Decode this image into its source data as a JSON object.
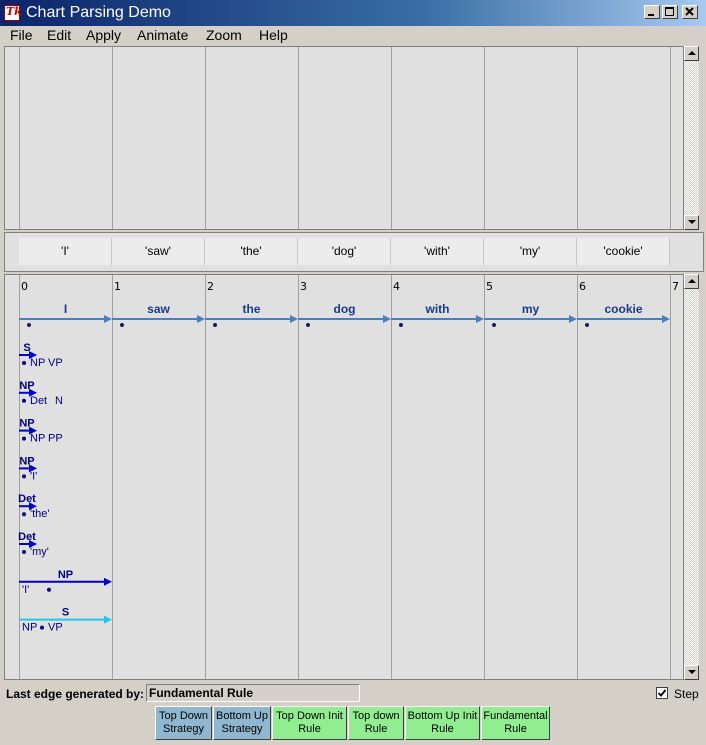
{
  "window": {
    "title": "Chart Parsing Demo"
  },
  "menu": [
    "File",
    "Edit",
    "Apply",
    "Animate",
    "Zoom",
    "Help"
  ],
  "tokens": [
    "'I'",
    "'saw'",
    "'the'",
    "'dog'",
    "'with'",
    "'my'",
    "'cookie'"
  ],
  "indices": [
    "0",
    "1",
    "2",
    "3",
    "4",
    "5",
    "6",
    "7"
  ],
  "words": [
    "I",
    "saw",
    "the",
    "dog",
    "with",
    "my",
    "cookie"
  ],
  "edges": [
    {
      "lhs": "S",
      "rhs": "NP VP",
      "start": 0,
      "end": 0,
      "dot": 0
    },
    {
      "lhs": "NP",
      "rhs": "Det N",
      "start": 0,
      "end": 0,
      "dot": 0
    },
    {
      "lhs": "NP",
      "rhs": "NP PP",
      "start": 0,
      "end": 0,
      "dot": 0
    },
    {
      "lhs": "NP",
      "rhs": "'I'",
      "start": 0,
      "end": 0,
      "dot": 0
    },
    {
      "lhs": "Det",
      "rhs": "'the'",
      "start": 0,
      "end": 0,
      "dot": 0
    },
    {
      "lhs": "Det",
      "rhs": "'my'",
      "start": 0,
      "end": 0,
      "dot": 0
    },
    {
      "lhs": "NP",
      "rhs": "'I'",
      "start": 0,
      "end": 1,
      "dot": 1
    },
    {
      "lhs": "S",
      "rhs": "NP VP",
      "start": 0,
      "end": 1,
      "dot": 1,
      "highlight": true
    }
  ],
  "colors": {
    "word_edge": "#4a7fc0",
    "edge": "#0000cc",
    "highlight_edge": "#20c8e8",
    "strategy_button": "#8fb8d0",
    "rule_button": "#90ee90"
  },
  "status": {
    "label": "Last edge generated by:",
    "value": "Fundamental Rule",
    "step_label": "Step",
    "step_checked": true
  },
  "buttons": [
    {
      "label": "Top Down\nStrategy",
      "kind": "strategy"
    },
    {
      "label": "Bottom Up\nStrategy",
      "kind": "strategy"
    },
    {
      "label": "Top Down Init\nRule",
      "kind": "rule"
    },
    {
      "label": "Top down\nRule",
      "kind": "rule"
    },
    {
      "label": "Bottom Up Init\nRule",
      "kind": "rule"
    },
    {
      "label": "Fundamental\nRule",
      "kind": "rule"
    }
  ]
}
